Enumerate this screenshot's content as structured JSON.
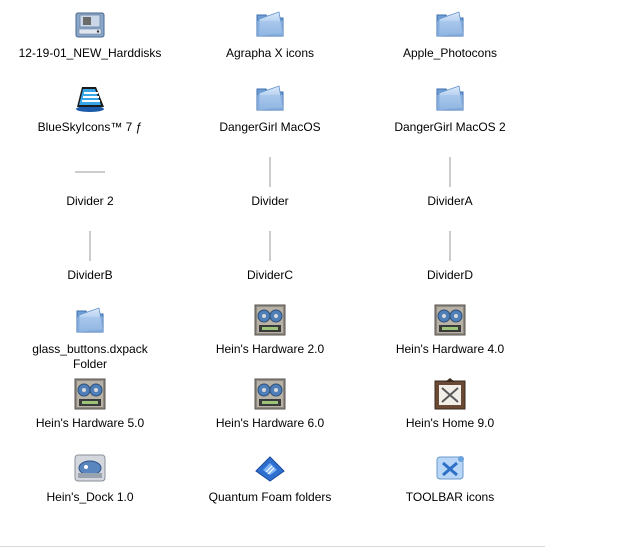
{
  "icons": [
    {
      "label": "12-19-01_NEW_Harddisks",
      "icon": "harddisk-folder-icon"
    },
    {
      "label": "Agrapha X icons",
      "icon": "folder-icon"
    },
    {
      "label": "Apple_Photocons",
      "icon": "folder-icon"
    },
    {
      "label": "BlueSkyIcons™ 7 ƒ",
      "icon": "bluesky-app-icon"
    },
    {
      "label": "DangerGirl MacOS",
      "icon": "folder-icon"
    },
    {
      "label": "DangerGirl MacOS 2",
      "icon": "folder-icon"
    },
    {
      "label": "Divider 2",
      "icon": "horizontal-divider-icon"
    },
    {
      "label": "Divider",
      "icon": "vertical-divider-icon"
    },
    {
      "label": "DividerA",
      "icon": "vertical-divider-icon"
    },
    {
      "label": "DividerB",
      "icon": "vertical-divider-icon"
    },
    {
      "label": "DividerC",
      "icon": "vertical-divider-icon"
    },
    {
      "label": "DividerD",
      "icon": "vertical-divider-icon"
    },
    {
      "label": "glass_buttons.dxpack\nFolder",
      "icon": "folder-icon"
    },
    {
      "label": "Hein's Hardware 2.0",
      "icon": "hardware-icon"
    },
    {
      "label": "Hein's Hardware 4.0",
      "icon": "hardware-icon"
    },
    {
      "label": "Hein's Hardware 5.0",
      "icon": "hardware-icon"
    },
    {
      "label": "Hein's Hardware 6.0",
      "icon": "hardware-icon"
    },
    {
      "label": "Hein's Home 9.0",
      "icon": "home-frame-icon"
    },
    {
      "label": "Hein's_Dock 1.0",
      "icon": "dock-icon"
    },
    {
      "label": "Quantum Foam folders",
      "icon": "blue-foam-icon"
    },
    {
      "label": "TOOLBAR icons",
      "icon": "toolbar-icon"
    }
  ],
  "colors": {
    "folder_light": "#cfe3fa",
    "folder_mid": "#8fb8e6",
    "folder_dark": "#4a7fbf",
    "divider": "#9a9a9a"
  }
}
